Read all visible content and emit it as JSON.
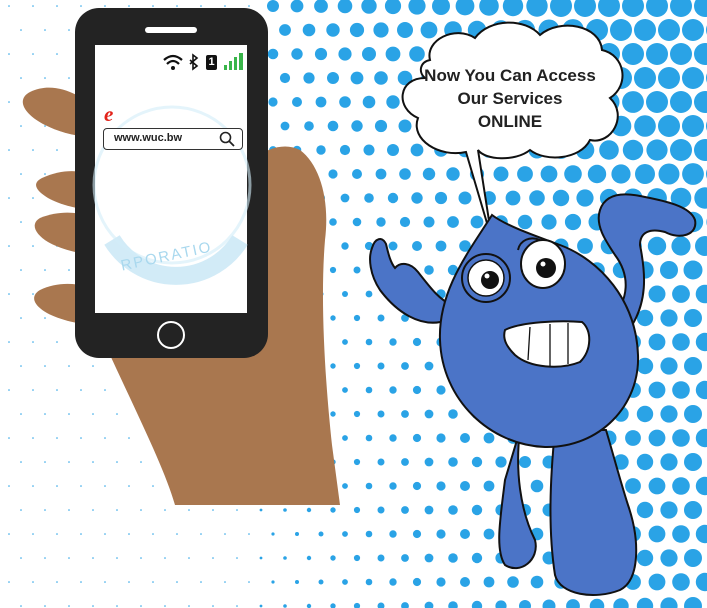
{
  "speech_bubble": {
    "line1": "Now You Can Access",
    "line2": "Our Services",
    "line3": "ONLINE"
  },
  "phone": {
    "url": "www.wuc.bw",
    "sim_indicator": "1",
    "logo_letter": "e",
    "watermark_text": "RPORATIO",
    "status_icons": [
      "wifi-icon",
      "bluetooth-icon",
      "sim-icon",
      "signal-icon"
    ]
  },
  "colors": {
    "mascot_blue": "#4b74c7",
    "dot_blue": "#2aa3e6",
    "hand_brown": "#a9774f",
    "phone_body": "#232323",
    "signal_green": "#39b54a",
    "logo_red": "#e2231a"
  }
}
